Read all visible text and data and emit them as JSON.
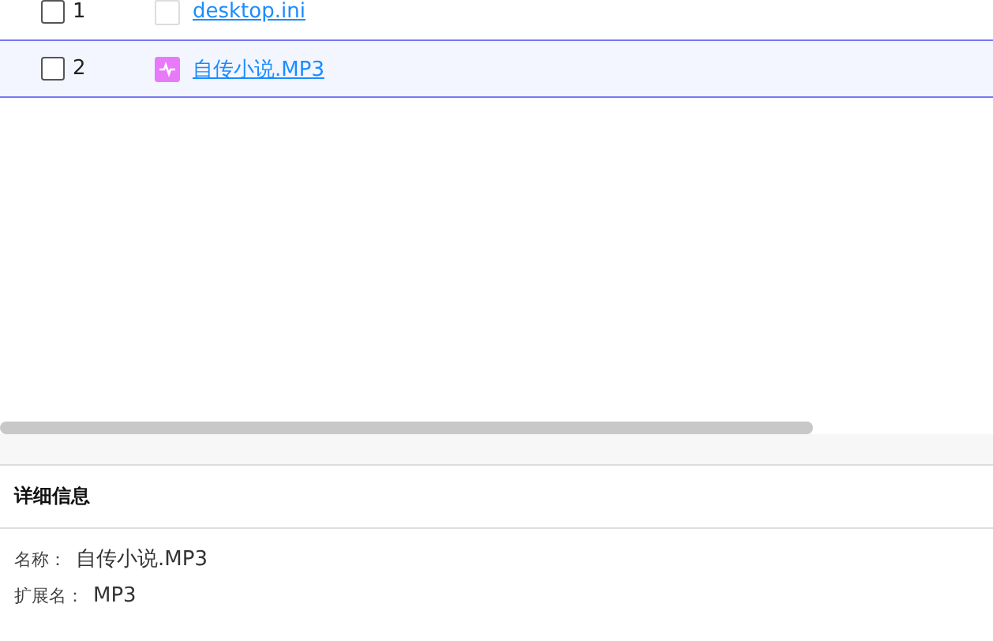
{
  "files": [
    {
      "index": "1",
      "name": "desktop.ini",
      "kind": "blank",
      "checked": false,
      "highlighted": false
    },
    {
      "index": "2",
      "name": "自传小说.MP3",
      "kind": "audio",
      "checked": false,
      "highlighted": true
    }
  ],
  "details": {
    "title": "详细信息",
    "fields": [
      {
        "label": "名称：",
        "value": "自传小说.MP3"
      },
      {
        "label": "扩展名：",
        "value": "MP3"
      }
    ]
  }
}
